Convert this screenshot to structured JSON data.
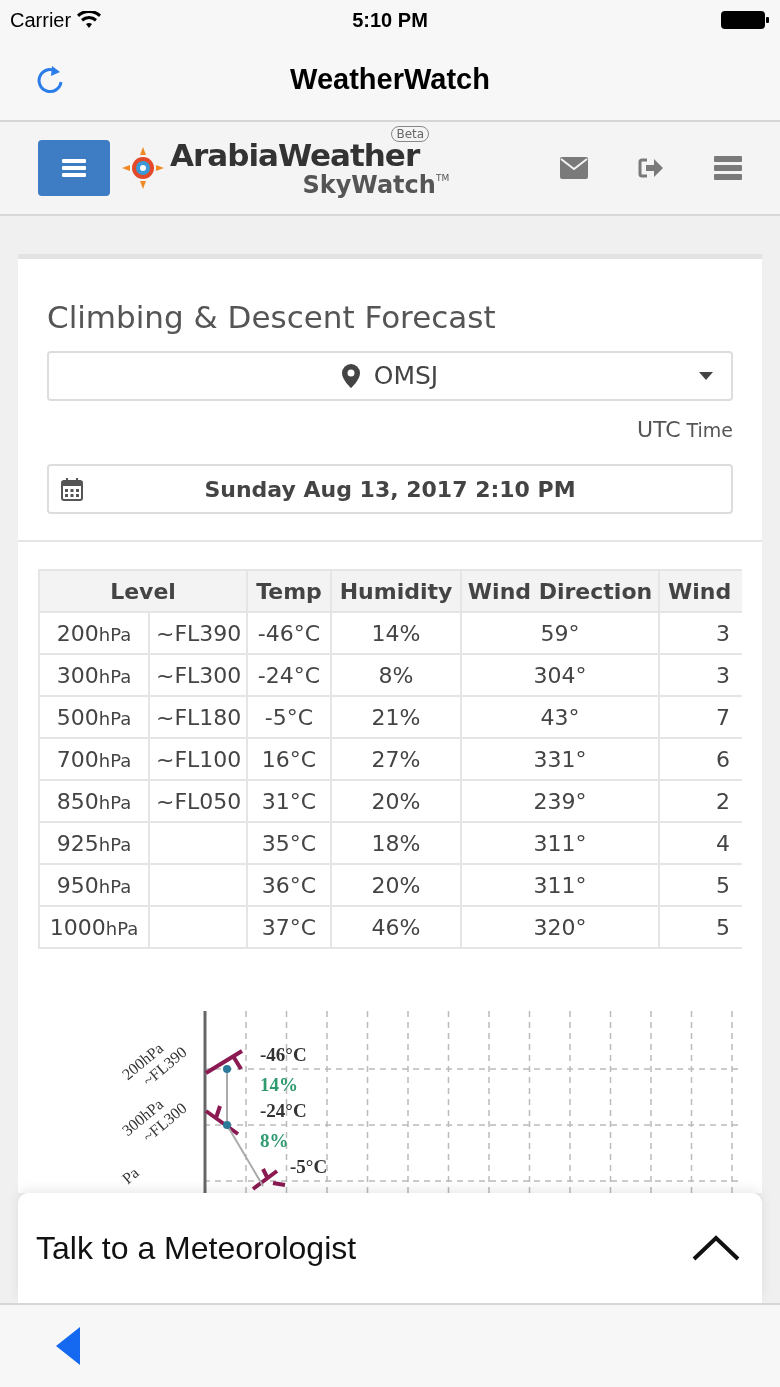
{
  "status_bar": {
    "carrier": "Carrier",
    "time": "5:10 PM"
  },
  "nav_bar": {
    "title": "WeatherWatch"
  },
  "header": {
    "brand": "ArabiaWeather",
    "product": "SkyWatch",
    "trademark": "TM",
    "badge": "Beta"
  },
  "card": {
    "title": "Climbing & Descent Forecast",
    "station": "OMSJ",
    "time_zone": {
      "main": "UTC",
      "unit": "Time"
    },
    "date": "Sunday Aug 13, 2017 2:10 PM"
  },
  "table": {
    "columns": [
      "Level",
      "Temp",
      "Humidity",
      "Wind Direction",
      "Wind"
    ],
    "rows": [
      {
        "pressure": "200",
        "unit": "hPa",
        "flight_level": "~FL390",
        "temp": "-46°C",
        "humidity": "14%",
        "wind_direction": "59°",
        "wind": "3"
      },
      {
        "pressure": "300",
        "unit": "hPa",
        "flight_level": "~FL300",
        "temp": "-24°C",
        "humidity": "8%",
        "wind_direction": "304°",
        "wind": "3"
      },
      {
        "pressure": "500",
        "unit": "hPa",
        "flight_level": "~FL180",
        "temp": "-5°C",
        "humidity": "21%",
        "wind_direction": "43°",
        "wind": "7"
      },
      {
        "pressure": "700",
        "unit": "hPa",
        "flight_level": "~FL100",
        "temp": "16°C",
        "humidity": "27%",
        "wind_direction": "331°",
        "wind": "6"
      },
      {
        "pressure": "850",
        "unit": "hPa",
        "flight_level": "~FL050",
        "temp": "31°C",
        "humidity": "20%",
        "wind_direction": "239°",
        "wind": "2"
      },
      {
        "pressure": "925",
        "unit": "hPa",
        "temp": "35°C",
        "humidity": "18%",
        "wind_direction": "311°",
        "wind": "4"
      },
      {
        "pressure": "950",
        "unit": "hPa",
        "temp": "36°C",
        "humidity": "20%",
        "wind_direction": "311°",
        "wind": "5"
      },
      {
        "pressure": "1000",
        "unit": "hPa",
        "temp": "37°C",
        "humidity": "46%",
        "wind_direction": "320°",
        "wind": "5"
      }
    ]
  },
  "profile": {
    "levels": [
      {
        "pressure": "200hPa",
        "flight_level": "~FL390",
        "temp": "-46°C",
        "humidity": "14%"
      },
      {
        "pressure": "300hPa",
        "flight_level": "~FL300",
        "temp": "-24°C",
        "humidity": "8%"
      },
      {
        "pressure": "Pa",
        "temp": "-5°C"
      }
    ]
  },
  "bottom_sheet": {
    "title": "Talk to a Meteorologist"
  }
}
